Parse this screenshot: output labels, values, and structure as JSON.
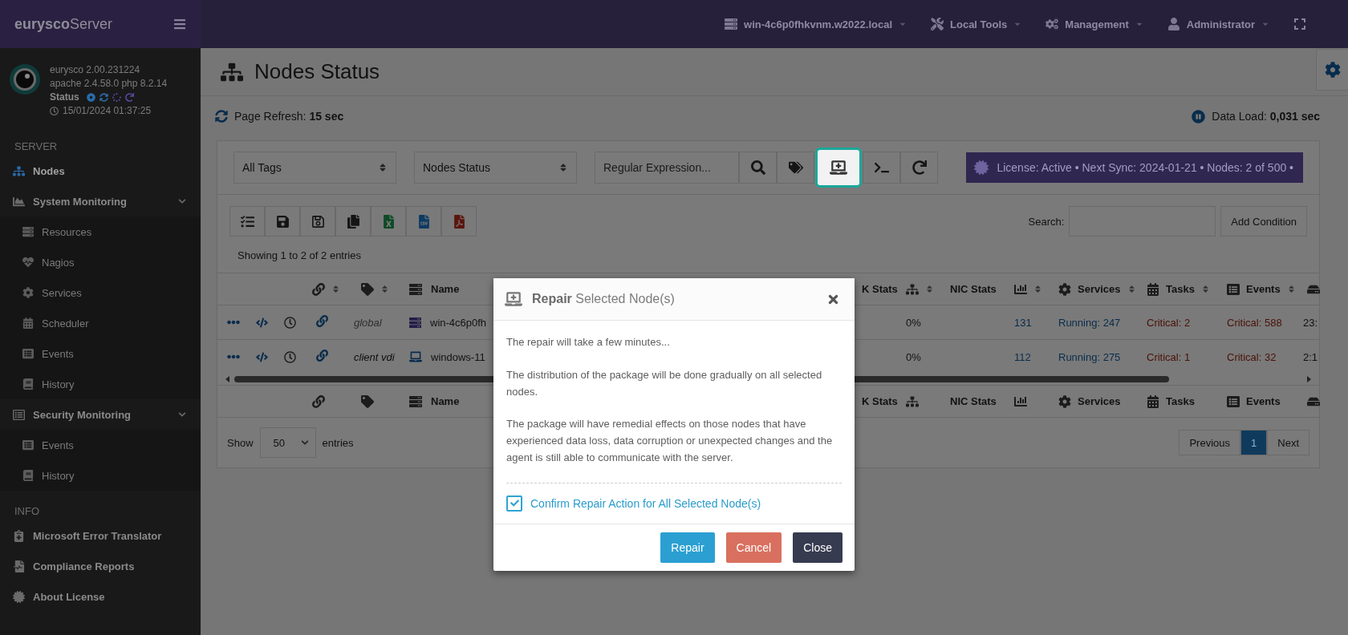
{
  "topbar": {
    "logo": "**eurysco**Server",
    "menus": [
      {
        "label": "win-4c6p0fhkvnm.w2022.local"
      },
      {
        "label": "Local Tools"
      },
      {
        "label": "Management"
      },
      {
        "label": "Administrator"
      }
    ]
  },
  "profile": {
    "lines": [
      "eurysco 2.00.231224",
      "apache 2.4.58.0 php 8.2.14"
    ],
    "status": "Status",
    "time": "15/01/2024 01:37:25"
  },
  "sidebar": {
    "sections": [
      {
        "title": "SERVER",
        "items": [
          {
            "label": "Nodes",
            "selected": true
          },
          {
            "label": "System Monitoring",
            "selected": false,
            "expanded": true,
            "children": [
              {
                "label": "Resources",
                "selected": false
              },
              {
                "label": "Nagios",
                "selected": false
              },
              {
                "label": "Services",
                "selected": false
              },
              {
                "label": "Scheduler",
                "selected": false
              },
              {
                "label": "Events",
                "selected": false
              },
              {
                "label": "History",
                "selected": false
              }
            ]
          },
          {
            "label": "Security Monitoring",
            "selected": false,
            "expanded": true,
            "children": [
              {
                "label": "Events",
                "selected": false
              },
              {
                "label": "History",
                "selected": false
              }
            ]
          }
        ]
      },
      {
        "title": "INFO",
        "items": [
          {
            "label": "Microsoft Error Translator",
            "selected": false
          },
          {
            "label": "Compliance Reports",
            "selected": false
          },
          {
            "label": "About License",
            "selected": false
          }
        ]
      }
    ]
  },
  "page": {
    "title": "Nodes Status",
    "refresh_label": "Page Refresh:",
    "refresh_value": "15 sec",
    "load_label": "Data Load:",
    "load_value": "0,031 sec"
  },
  "filters": {
    "tags_select": "All Tags",
    "status_select": "Nodes Status",
    "regex_placeholder": "Regular Expression...",
    "license": "License: Active • Next Sync: 2024-01-21 • Nodes: 2 of 500 •"
  },
  "filter_buttons": [
    {
      "kind": "search",
      "highlighted": false
    },
    {
      "kind": "tags",
      "highlighted": false
    },
    {
      "kind": "repair",
      "highlighted": true
    },
    {
      "kind": "terminal",
      "highlighted": false
    },
    {
      "kind": "refresh",
      "highlighted": false
    }
  ],
  "export_buttons": [
    {
      "kind": "select-all"
    },
    {
      "kind": "save"
    },
    {
      "kind": "unsave"
    },
    {
      "kind": "copy"
    },
    {
      "kind": "excel"
    },
    {
      "kind": "csv"
    },
    {
      "kind": "pdf"
    }
  ],
  "search": {
    "label": "Search:",
    "add_condition": "Add Condition"
  },
  "showing": "Showing 1 to 2 of 2 entries",
  "table": {
    "columns": [
      {
        "kind": "link",
        "sortable": true
      },
      {
        "kind": "tag",
        "sortable": true
      },
      {
        "kind": "name",
        "label": "Name",
        "sortable": false
      },
      {
        "kind": "disk",
        "label": "K Stats"
      },
      {
        "kind": "network",
        "sortable": true
      },
      {
        "kind": "nic",
        "label": "NIC Stats",
        "sortable": false
      },
      {
        "kind": "chart",
        "sortable": true
      },
      {
        "kind": "services",
        "label": "Services",
        "sortable": true
      },
      {
        "kind": "tasks",
        "label": "Tasks",
        "sortable": true
      },
      {
        "kind": "events",
        "label": "Events",
        "sortable": true
      },
      {
        "kind": "extra"
      }
    ],
    "rows": [
      {
        "tag": "global",
        "muted": true,
        "kind": "server",
        "name": "win-4c6p0fh",
        "net": "0%",
        "count": "131",
        "services": "Running: 247",
        "tasks": "Critical: 2",
        "events": "Critical: 588",
        "extra": "23:"
      },
      {
        "tag": "client vdi",
        "muted": false,
        "kind": "laptop",
        "name": "windows-11",
        "net": "0%",
        "count": "112",
        "services": "Running: 275",
        "tasks": "Critical: 1",
        "events": "Critical: 32",
        "extra": "2:1"
      }
    ],
    "footer_columns": [
      {
        "kind": "link"
      },
      {
        "kind": "tag"
      },
      {
        "kind": "name",
        "label": "Name"
      },
      {
        "kind": "disk",
        "label": "K Stats"
      },
      {
        "kind": "network"
      },
      {
        "kind": "nic",
        "label": "NIC Stats"
      },
      {
        "kind": "chart"
      },
      {
        "kind": "services",
        "label": "Services"
      },
      {
        "kind": "tasks",
        "label": "Tasks"
      },
      {
        "kind": "events",
        "label": "Events"
      },
      {
        "kind": "extra"
      }
    ]
  },
  "entries": {
    "show": "Show",
    "value": "50",
    "suffix": "entries"
  },
  "pagination": [
    {
      "label": "Previous",
      "selected": false
    },
    {
      "label": "1",
      "selected": true
    },
    {
      "label": "Next",
      "selected": false
    }
  ],
  "modal": {
    "title": "**Repair** Selected Node(s)",
    "paragraphs": [
      "The repair will take a few minutes...",
      "The distribution of the package will be done gradually on all selected nodes.",
      "The package will have remedial effects on those nodes that have experienced data loss, data corruption or unexpected changes and the agent is still able to communicate with the server."
    ],
    "confirm": {
      "label": "Confirm Repair Action for All Selected Node(s)",
      "checked": true
    },
    "buttons": [
      {
        "label": "Repair",
        "kind": "primary"
      },
      {
        "label": "Cancel",
        "kind": "danger"
      },
      {
        "label": "Close",
        "kind": "dark"
      }
    ]
  }
}
